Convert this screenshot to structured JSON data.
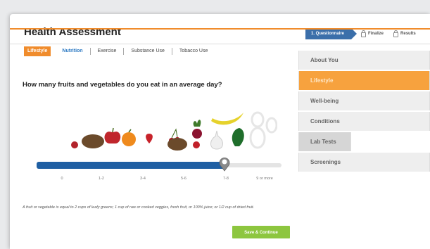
{
  "header": {
    "title": "Health Assessment",
    "steps": [
      {
        "label": "1. Questionnaire"
      },
      {
        "label": "Finalize"
      },
      {
        "label": "Results"
      }
    ]
  },
  "tabs": [
    "Lifestyle",
    "Nutrition",
    "Exercise",
    "Substance Use",
    "Tobacco Use"
  ],
  "question": "How many fruits and vegetables do you eat in an average day?",
  "slider": {
    "ticks": [
      "0",
      "1-2",
      "3-4",
      "5-6",
      "7-8",
      "9 or more"
    ],
    "selected": "7-8"
  },
  "footnote": "A fruit or vegetable is equal to 2 cups of leafy greens; 1 cup of raw or cooked veggies, fresh fruit, or 100% juice; or 1/2 cup of dried fruit.",
  "save_button": "Save & Continue",
  "sidebar": {
    "items": [
      "About You",
      "Lifestyle",
      "Well-being",
      "Conditions",
      "Lab Tests",
      "Screenings"
    ]
  },
  "colors": {
    "accent_orange": "#f08c2c",
    "slider_blue": "#1f5fa3",
    "button_green": "#8dc63f",
    "step_blue": "#3b6faa"
  }
}
